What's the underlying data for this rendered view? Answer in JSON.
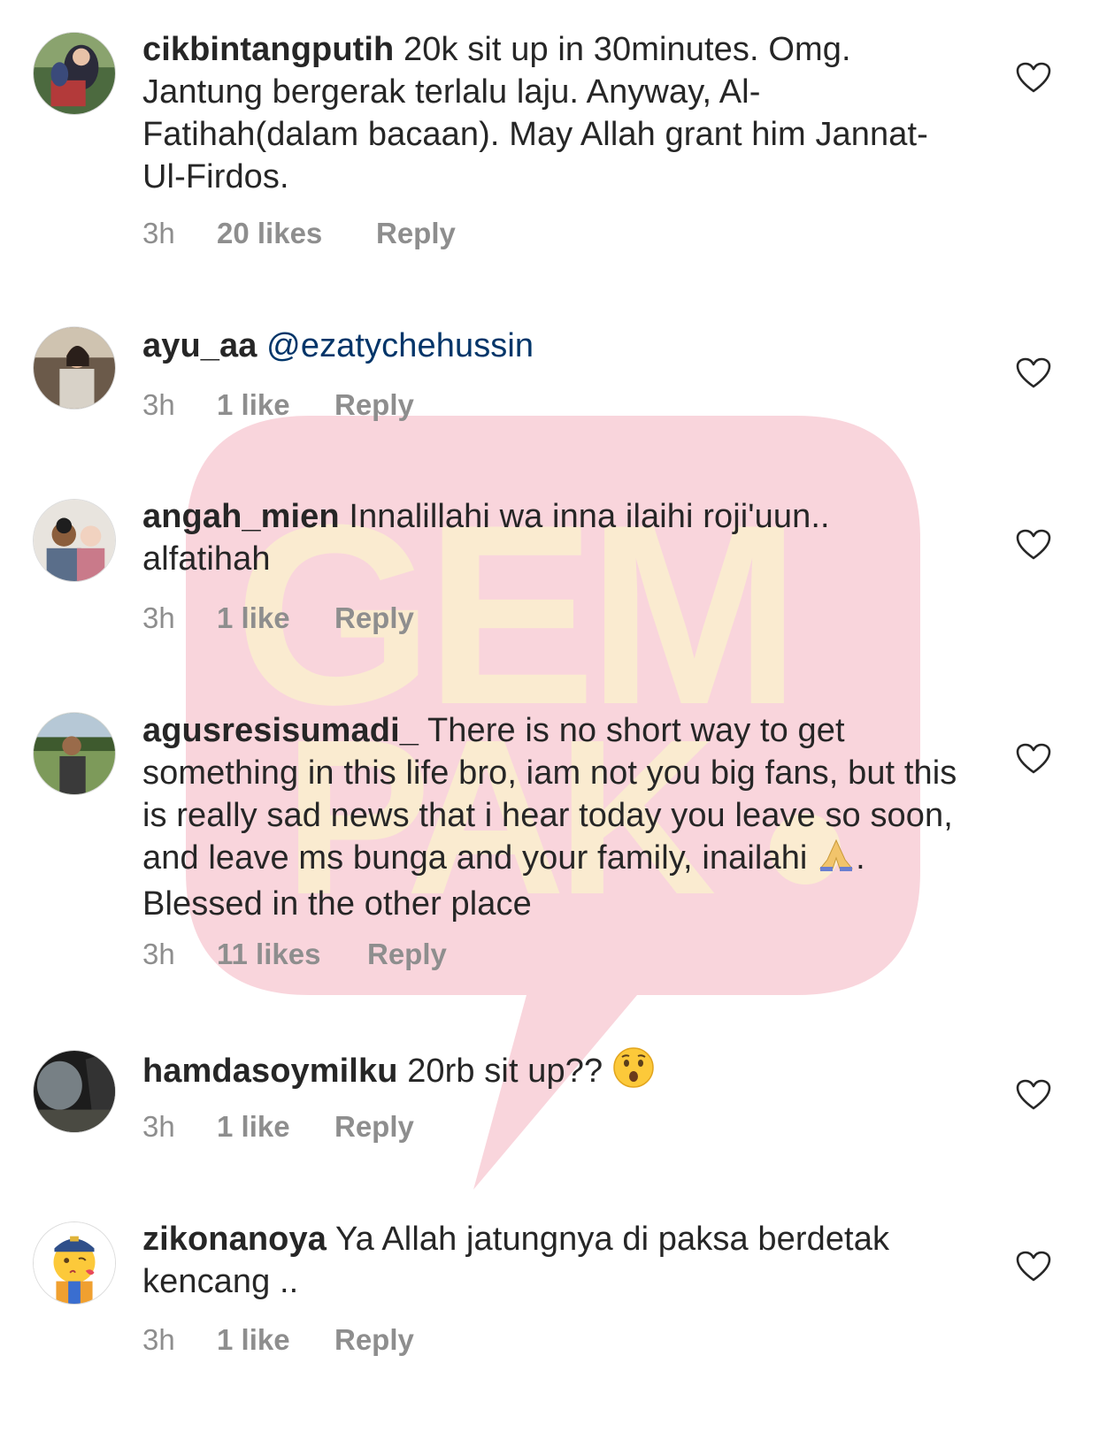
{
  "watermark": {
    "line1": "GEM",
    "line2": "PAK",
    "bubble_color": "#f9d3da",
    "letter_color": "#fbeecf"
  },
  "comments": [
    {
      "username": "cikbintangputih",
      "text": "20k sit up in 30minutes. Omg. Jantung bergerak terlalu laju. Anyway, Al-Fatihah(dalam bacaan). May Allah grant him Jannat-Ul-Firdos.",
      "time": "3h",
      "likes": "20 likes",
      "reply": "Reply"
    },
    {
      "username": "ayu_aa",
      "mention": "@ezatychehussin",
      "text": "",
      "time": "3h",
      "likes": "1 like",
      "reply": "Reply"
    },
    {
      "username": "angah_mien",
      "text": "Innalillahi wa inna ilaihi roji'uun.. alfatihah",
      "time": "3h",
      "likes": "1 like",
      "reply": "Reply"
    },
    {
      "username": "agusresisumadi_",
      "text": "There is no short way to get something in this life bro, iam not you big fans, but this is really sad news that i hear today you leave so soon, and leave ms bunga and your family, inailahi",
      "text2": ". Blessed in the other place",
      "emoji": "folded-hands",
      "time": "3h",
      "likes": "11 likes",
      "reply": "Reply"
    },
    {
      "username": "hamdasoymilku",
      "text": "20rb sit up??",
      "emoji": "astonished-face",
      "time": "3h",
      "likes": "1 like",
      "reply": "Reply"
    },
    {
      "username": "zikonanoya",
      "text": "Ya Allah jatungnya di paksa berdetak kencang ..",
      "time": "3h",
      "likes": "1 like",
      "reply": "Reply"
    }
  ],
  "colors": {
    "text": "#262626",
    "meta": "#8e8e8e",
    "mention": "#003569",
    "heart": "#262626"
  }
}
